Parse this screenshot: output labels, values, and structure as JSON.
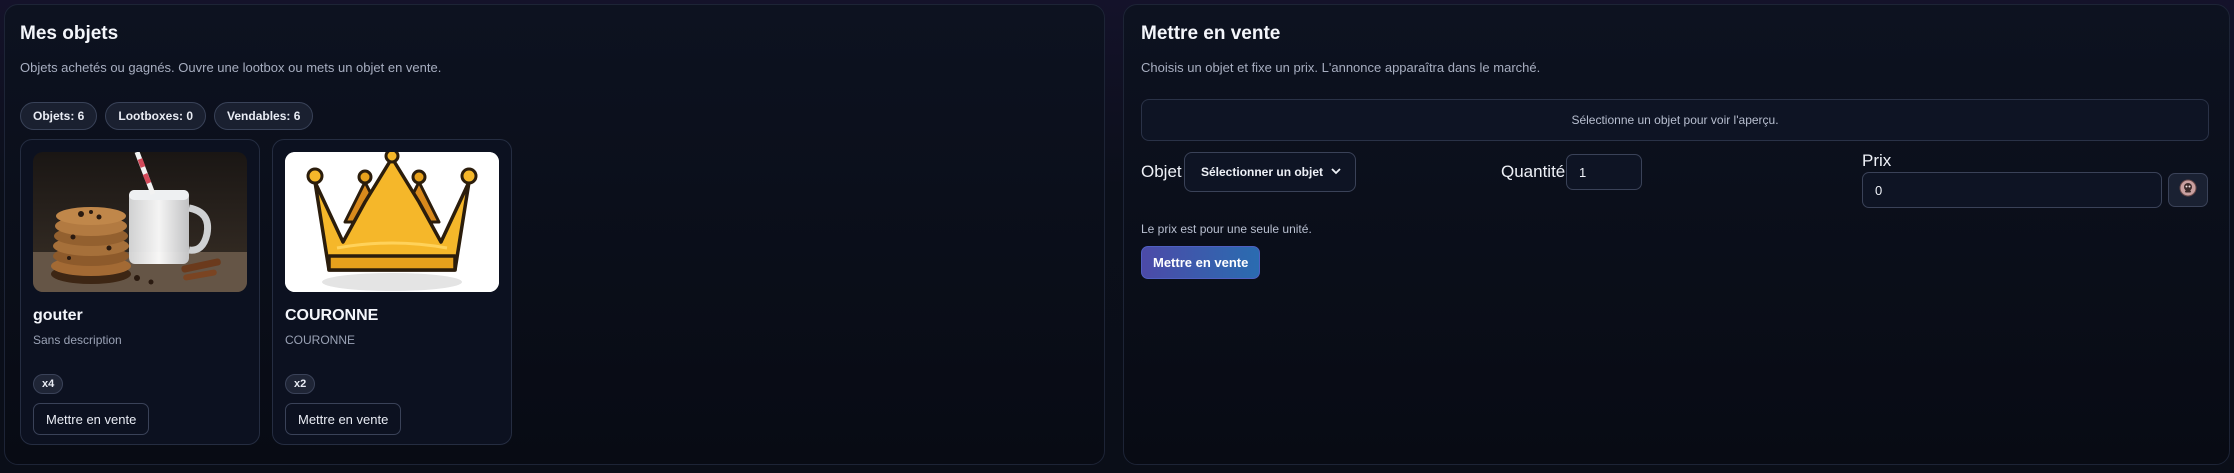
{
  "inventory": {
    "title": "Mes objets",
    "subtitle": "Objets achetés ou gagnés. Ouvre une lootbox ou mets un objet en vente.",
    "stats": [
      {
        "label": "Objets: 6"
      },
      {
        "label": "Lootboxes: 0"
      },
      {
        "label": "Vendables: 6"
      }
    ],
    "items": [
      {
        "name": "gouter",
        "description": "Sans description",
        "quantity": "x4",
        "sell_label": "Mettre en vente",
        "image": "cookies-milk-photo"
      },
      {
        "name": "COURONNE",
        "description": "COURONNE",
        "quantity": "x2",
        "sell_label": "Mettre en vente",
        "image": "crown-illustration"
      }
    ]
  },
  "sell_form": {
    "title": "Mettre en vente",
    "subtitle": "Choisis un objet et fixe un prix. L'annonce apparaîtra dans le marché.",
    "preview_placeholder": "Sélectionne un objet pour voir l'aperçu.",
    "object_label": "Objet",
    "object_select_value": "Sélectionner un objet",
    "quantity_label": "Quantité",
    "quantity_value": "1",
    "price_label": "Prix",
    "price_value": "0",
    "currency_icon": "coin-icon",
    "hint": "Le prix est pour une seule unité.",
    "submit_label": "Mettre en vente"
  },
  "colors": {
    "accent_start": "#4c4aa8",
    "accent_end": "#2a6cb0",
    "panel_bg": "#0d1220",
    "border": "#1d2436"
  }
}
